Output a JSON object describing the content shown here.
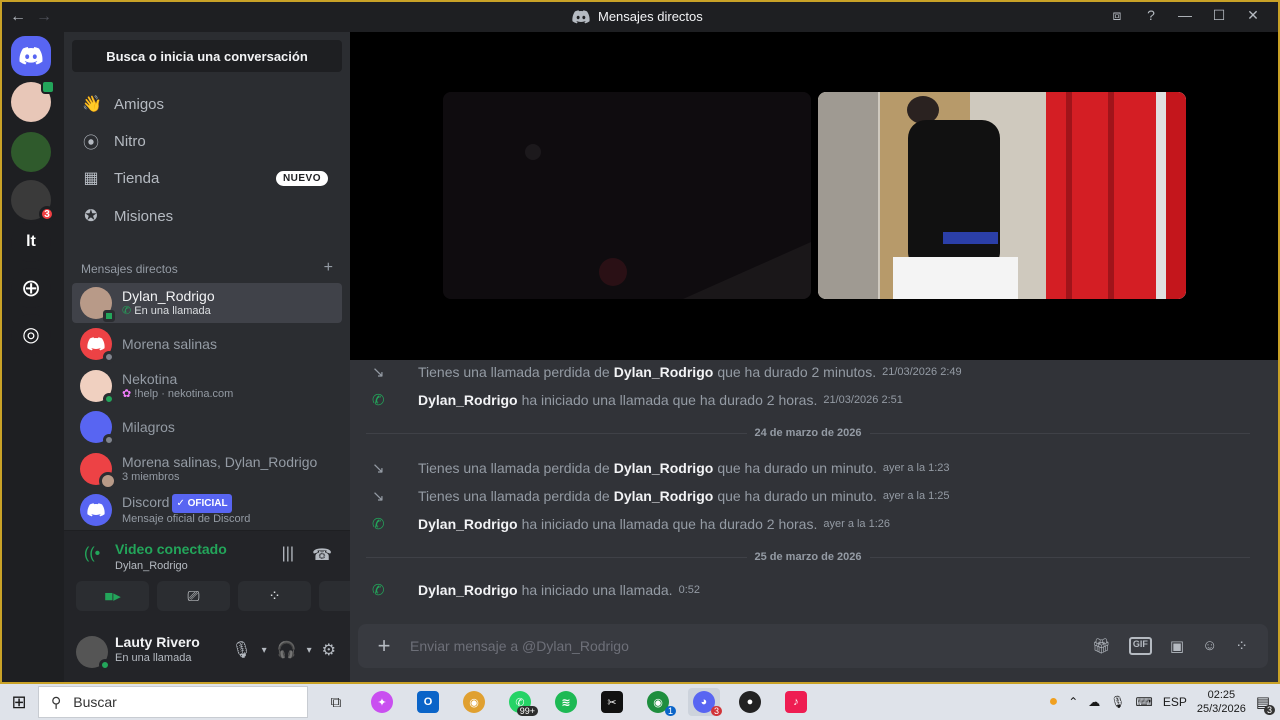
{
  "window": {
    "title": "Mensajes directos",
    "back": "←",
    "forward": "→"
  },
  "servers": [
    {
      "name": "inbox-avatar",
      "color": "#e8c7b8"
    },
    {
      "name": "server-2",
      "color": "#2f5a2c"
    },
    {
      "name": "server-3",
      "color": "#3a3a3a",
      "badge": "3"
    },
    {
      "name": "server-lt",
      "label": "lt",
      "color": "#313338"
    }
  ],
  "sidebar": {
    "search": "Busca o inicia una conversación",
    "nav": [
      {
        "label": "Amigos",
        "icon": "👋"
      },
      {
        "label": "Nitro",
        "icon": "⦿"
      },
      {
        "label": "Tienda",
        "icon": "▦",
        "badge": "NUEVO"
      },
      {
        "label": "Misiones",
        "icon": "✪"
      }
    ],
    "dm_header": "Mensajes directos",
    "dm_add": "+",
    "dms": [
      {
        "name": "Dylan_Rodrigo",
        "sub": "En una llamada",
        "sub_icon": "📞",
        "color": "#b89a88",
        "status": "#23a55a",
        "active": true
      },
      {
        "name": "Morena salinas",
        "sub": "",
        "color": "#ed4245",
        "status": "#80848e",
        "active": false
      },
      {
        "name": "Nekotina",
        "sub": "!help · nekotina.com",
        "sub_icon": "✿",
        "color": "#f0d0c0",
        "status": "#23a55a",
        "active": false
      },
      {
        "name": "Milagros",
        "sub": "",
        "color": "#5865f2",
        "status": "#80848e",
        "active": false
      },
      {
        "name": "Morena salinas, Dylan_Rodrigo",
        "sub": "3 miembros",
        "color": "#ed4245",
        "status": "",
        "active": false
      },
      {
        "name": "Discord",
        "badge": "✓ OFICIAL",
        "sub": "Mensaje oficial de Discord",
        "color": "#5865f2",
        "status": "",
        "active": false
      }
    ]
  },
  "voice": {
    "title": "Video conectado",
    "sub": "Dylan_Rodrigo"
  },
  "user": {
    "name": "Lauty Rivero",
    "status": "En una llamada"
  },
  "messages": [
    {
      "type": "missed",
      "pre": "Tienes una llamada perdida de",
      "user": "Dylan_Rodrigo",
      "post": "que ha durado 2 minutos.",
      "ts": "21/03/2026 2:49"
    },
    {
      "type": "started",
      "pre": "",
      "user": "Dylan_Rodrigo",
      "post": "ha iniciado una llamada que ha durado 2 horas.",
      "ts": "21/03/2026 2:51"
    },
    {
      "type": "divider",
      "label": "24 de marzo de 2026"
    },
    {
      "type": "missed",
      "pre": "Tienes una llamada perdida de",
      "user": "Dylan_Rodrigo",
      "post": "que ha durado un minuto.",
      "ts": "ayer a la 1:23"
    },
    {
      "type": "missed",
      "pre": "Tienes una llamada perdida de",
      "user": "Dylan_Rodrigo",
      "post": "que ha durado un minuto.",
      "ts": "ayer a la 1:25"
    },
    {
      "type": "started",
      "pre": "",
      "user": "Dylan_Rodrigo",
      "post": "ha iniciado una llamada que ha durado 2 horas.",
      "ts": "ayer a la 1:26"
    },
    {
      "type": "divider",
      "label": "25 de marzo de 2026"
    },
    {
      "type": "started",
      "pre": "",
      "user": "Dylan_Rodrigo",
      "post": "ha iniciado una llamada.",
      "ts": "0:52"
    }
  ],
  "composer": {
    "placeholder": "Enviar mensaje a @Dylan_Rodrigo",
    "gif": "GIF"
  },
  "taskbar": {
    "search": "Buscar",
    "apps": [
      {
        "name": "task-view",
        "glyph": "⧉",
        "color": "#555"
      },
      {
        "name": "copilot",
        "glyph": "✦",
        "color": "#c94ff0"
      },
      {
        "name": "outlook",
        "glyph": "O",
        "color": "#0a64c8"
      },
      {
        "name": "chrome",
        "glyph": "◉",
        "color": "#e0a030"
      },
      {
        "name": "whatsapp",
        "glyph": "✆",
        "color": "#25d366",
        "badge": "99+"
      },
      {
        "name": "spotify",
        "glyph": "≋",
        "color": "#1db954"
      },
      {
        "name": "capcut",
        "glyph": "✂",
        "color": "#111"
      },
      {
        "name": "chrome-profile",
        "glyph": "◉",
        "color": "#1e8e3e",
        "badge": "1"
      },
      {
        "name": "discord",
        "glyph": "◕",
        "color": "#5865f2",
        "badge": "3"
      },
      {
        "name": "obs",
        "glyph": "●",
        "color": "#222"
      },
      {
        "name": "tiktok",
        "glyph": "♪",
        "color": "#ee1d52"
      }
    ],
    "lang": "ESP",
    "time": "02:25",
    "date": "25/3/2026",
    "notif": "3"
  }
}
